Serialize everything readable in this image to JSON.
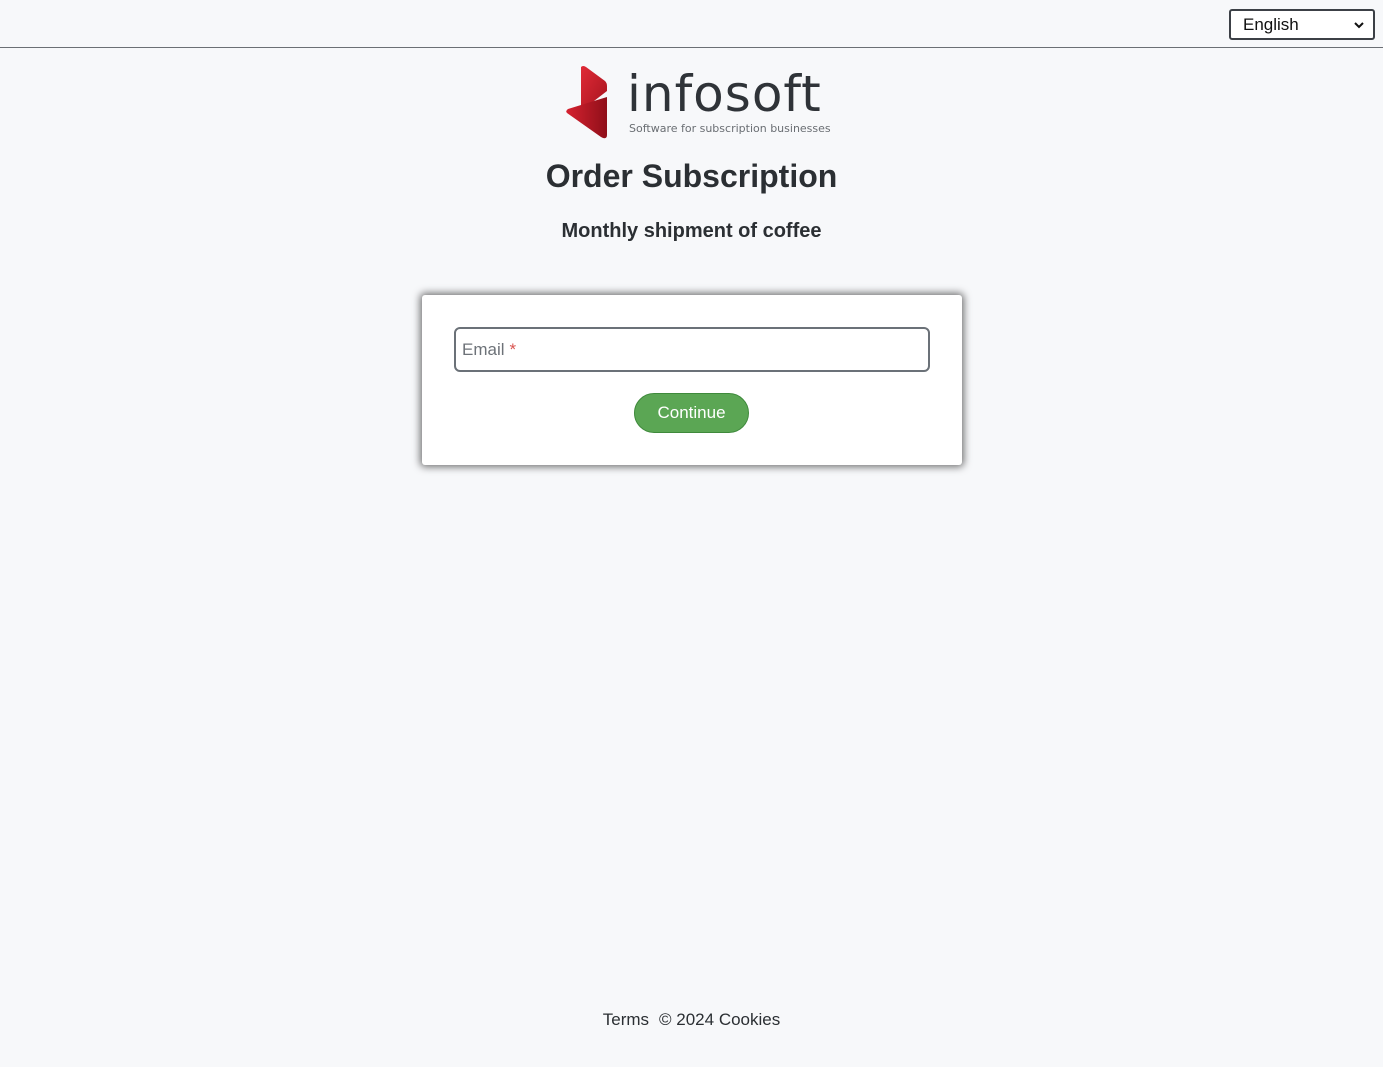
{
  "header": {
    "language": {
      "selected": "English",
      "icon": "chevron-down-icon"
    }
  },
  "brand": {
    "name": "infosoft",
    "tagline": "Software for subscription businesses",
    "logo_color": "#c8202f"
  },
  "page": {
    "title": "Order Subscription",
    "subtitle": "Monthly shipment of coffee"
  },
  "form": {
    "email_placeholder": "Email",
    "required_marker": "*",
    "continue_label": "Continue",
    "button_color": "#5ba654"
  },
  "footer": {
    "terms_label": "Terms",
    "copyright": "© 2024",
    "cookies_label": "Cookies"
  }
}
